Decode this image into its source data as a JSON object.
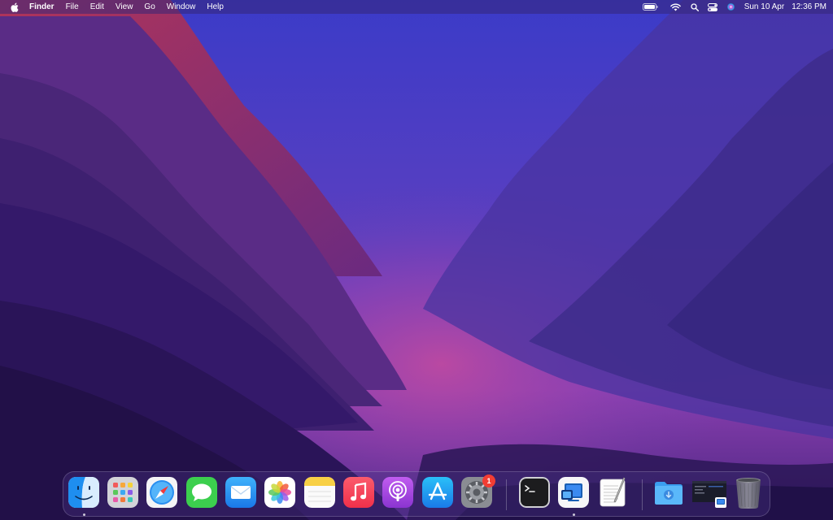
{
  "menubar": {
    "app_name": "Finder",
    "menus": [
      "File",
      "Edit",
      "View",
      "Go",
      "Window",
      "Help"
    ],
    "clock_date": "Sun 10 Apr",
    "clock_time": "12:36 PM",
    "status_icons": [
      "battery-icon",
      "wifi-icon",
      "spotlight-icon",
      "control-center-icon",
      "siri-icon"
    ]
  },
  "dock": {
    "apps": [
      {
        "name": "Finder",
        "icon": "finder-icon",
        "running": true
      },
      {
        "name": "Launchpad",
        "icon": "launchpad-icon",
        "running": false
      },
      {
        "name": "Safari",
        "icon": "safari-icon",
        "running": false
      },
      {
        "name": "Messages",
        "icon": "messages-icon",
        "running": false
      },
      {
        "name": "Mail",
        "icon": "mail-icon",
        "running": false
      },
      {
        "name": "Photos",
        "icon": "photos-icon",
        "running": false
      },
      {
        "name": "Notes",
        "icon": "notes-icon",
        "running": false
      },
      {
        "name": "Music",
        "icon": "music-icon",
        "running": false
      },
      {
        "name": "Podcasts",
        "icon": "podcasts-icon",
        "running": false
      },
      {
        "name": "App Store",
        "icon": "app-store-icon",
        "running": false
      },
      {
        "name": "System Preferences",
        "icon": "system-preferences-icon",
        "running": false,
        "badge": "1"
      },
      {
        "name": "Terminal",
        "icon": "terminal-icon",
        "running": false
      },
      {
        "name": "Microsoft Remote Desktop",
        "icon": "remote-desktop-icon",
        "running": true
      },
      {
        "name": "TextEdit",
        "icon": "textedit-icon",
        "running": false
      },
      {
        "name": "Downloads",
        "icon": "downloads-folder-icon",
        "running": false
      },
      {
        "name": "Recent Screenshot",
        "icon": "screenshot-stack-icon",
        "running": false
      },
      {
        "name": "Trash",
        "icon": "trash-icon",
        "running": false
      }
    ],
    "system_preferences_badge": "1"
  },
  "colors": {
    "wallpaper_top": "#3b3fc4",
    "wallpaper_mid": "#6a3fb5",
    "wallpaper_glow": "#b2459e",
    "wallpaper_dark": "#1e123f",
    "badge_red": "#f23d33"
  }
}
